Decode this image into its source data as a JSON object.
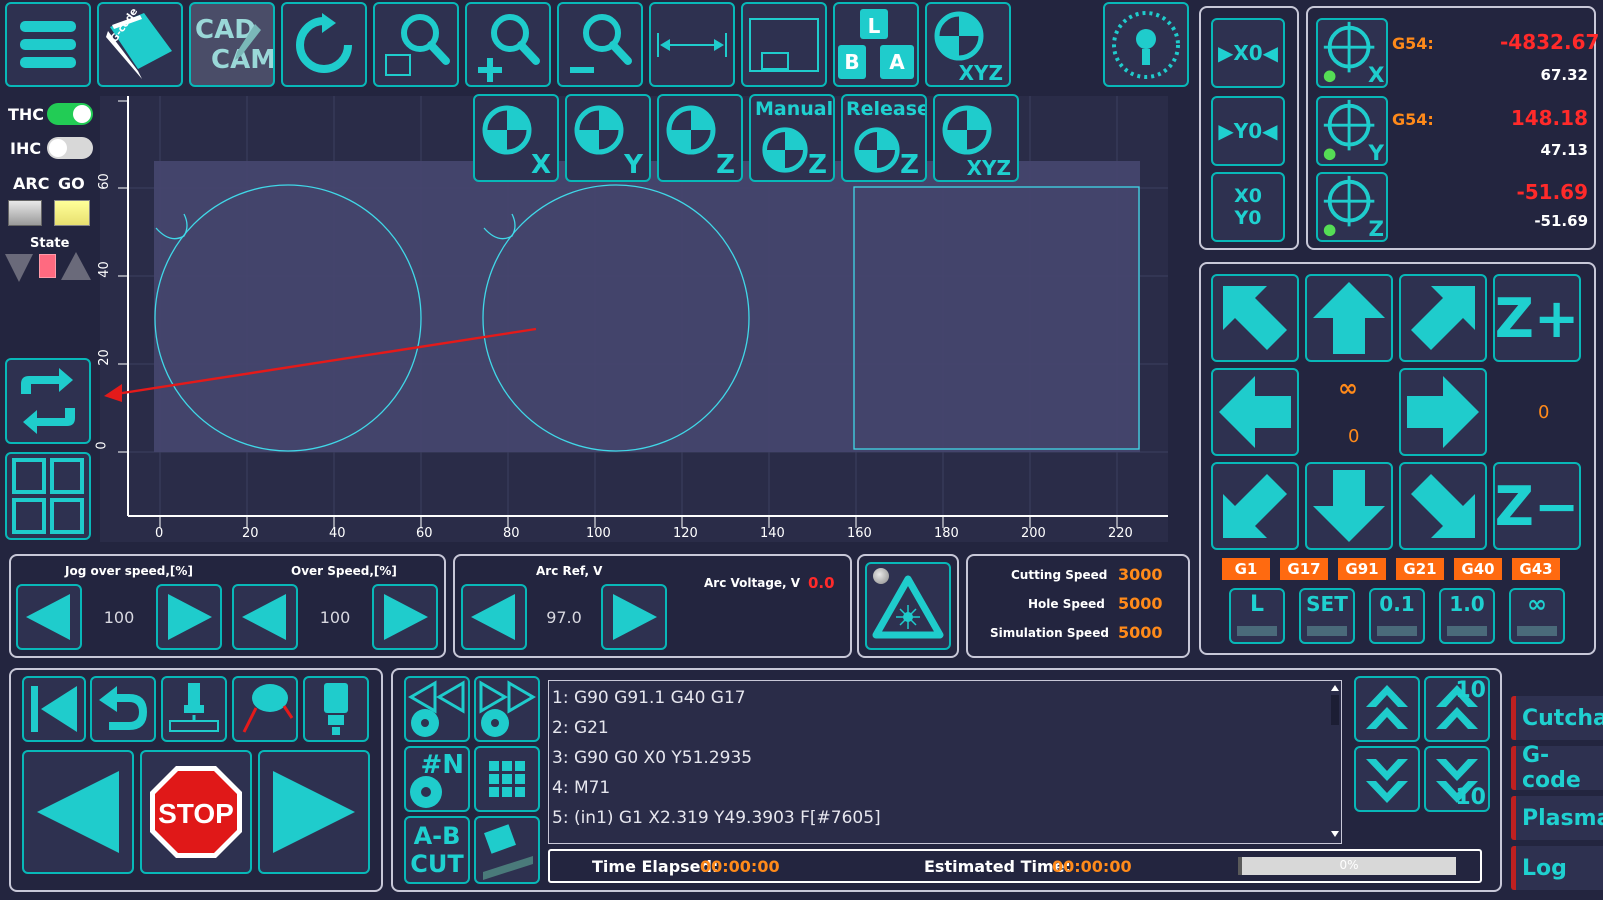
{
  "left": {
    "thc_label": "THC",
    "ihc_label": "IHC",
    "arc_label": "ARC",
    "go_label": "GO",
    "state_label": "State",
    "thc_on": true,
    "ihc_on": false
  },
  "toolbar": {
    "cad_label": "CAD",
    "cam_label": "CAM",
    "gcode_label": "G-code",
    "xyz_label": "XYZ",
    "manual_label": "Manual",
    "release_label": "Release",
    "x_label": "X",
    "y_label": "Y",
    "z_label": "Z"
  },
  "plot": {
    "x_ticks": [
      "0",
      "20",
      "40",
      "60",
      "80",
      "100",
      "120",
      "140",
      "160",
      "180",
      "200",
      "220"
    ],
    "y_ticks": [
      "0",
      "20",
      "40",
      "60"
    ]
  },
  "dro": {
    "x_btn": "▶X0◀",
    "y_btn": "▶Y0◀",
    "xy_btn_1": "X0",
    "xy_btn_2": "Y0",
    "rows": [
      {
        "axis": "X",
        "wcs": "G54:",
        "work": "-4832.67",
        "machine": "67.32"
      },
      {
        "axis": "Y",
        "wcs": "G54:",
        "work": "148.18",
        "machine": "47.13"
      },
      {
        "axis": "Z",
        "wcs": "",
        "work": "-51.69",
        "machine": "-51.69"
      }
    ]
  },
  "jog": {
    "z_plus": "Z+",
    "z_minus": "Z−",
    "infinity": "∞",
    "step_value": "0",
    "z_value": "0",
    "gcodes": [
      "G1",
      "G17",
      "G91",
      "G21",
      "G40",
      "G43"
    ],
    "steps": [
      "L",
      "SET",
      "0.1",
      "1.0",
      "∞"
    ]
  },
  "speed": {
    "jog_over_label": "Jog over speed,[%]",
    "over_label": "Over Speed,[%]",
    "jog_over_value": "100",
    "over_value": "100"
  },
  "arc": {
    "ref_label": "Arc Ref, V",
    "ref_value": "97.0",
    "voltage_label": "Arc Voltage, V",
    "voltage_value": "0.0"
  },
  "speeds": {
    "cutting_label": "Cutting Speed",
    "cutting_value": "3000",
    "hole_label": "Hole Speed",
    "hole_value": "5000",
    "sim_label": "Simulation Speed",
    "sim_value": "5000"
  },
  "run": {
    "stop_label": "STOP",
    "n_label": "#N",
    "ab_label_1": "A-B",
    "ab_label_2": "CUT"
  },
  "gcode": {
    "lines": [
      "1: G90 G91.1 G40 G17",
      "2: G21",
      "3: G90 G0 X0 Y51.2935",
      "4: M71",
      "5: (in1) G1 X2.319 Y49.3903 F[#7605]"
    ],
    "time_elapsed_label": "Time Elapsed:",
    "time_elapsed_value": "00:00:00",
    "estimated_label": "Estimated Time:",
    "estimated_value": "00:00:00",
    "progress_label": "0%",
    "progress_fraction": 0
  },
  "scroll": {
    "ten_top": "10",
    "ten_bottom": "10"
  },
  "tabs": [
    "Cutchart",
    "G-code",
    "Plasma",
    "Log"
  ],
  "colors": {
    "accent": "#1fcccc",
    "orange": "#ff6a10",
    "red": "#ff2a2a",
    "bg": "#23253f"
  }
}
